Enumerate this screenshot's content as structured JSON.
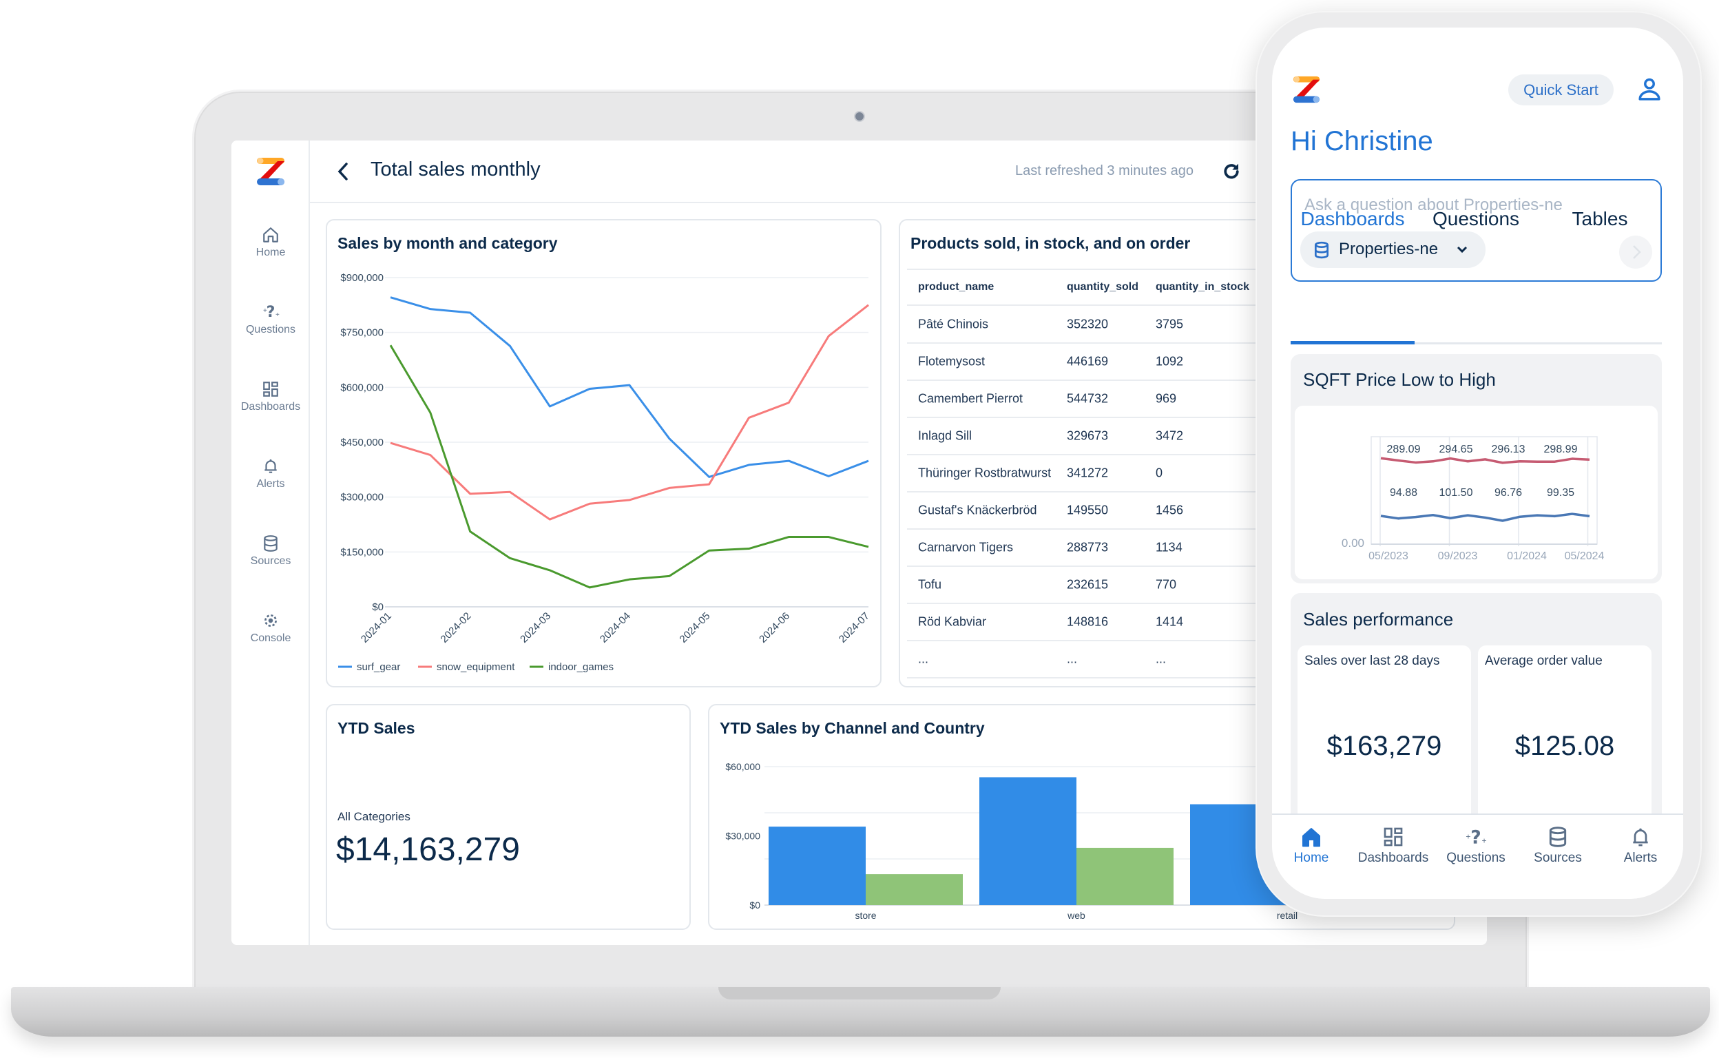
{
  "laptop": {
    "sidebar": {
      "items": [
        {
          "label": "Home",
          "icon": "home-icon"
        },
        {
          "label": "Questions",
          "icon": "sparkle-question-icon"
        },
        {
          "label": "Dashboards",
          "icon": "dashboard-grid-icon"
        },
        {
          "label": "Alerts",
          "icon": "bell-icon"
        },
        {
          "label": "Sources",
          "icon": "database-icon"
        },
        {
          "label": "Console",
          "icon": "gear-icon"
        }
      ]
    },
    "header": {
      "title": "Total sales monthly",
      "last_refreshed": "Last refreshed 3 minutes ago"
    },
    "line_card": {
      "title": "Sales by month and category"
    },
    "table_card": {
      "title": "Products sold, in stock, and on order",
      "columns": [
        "product_name",
        "quantity_sold",
        "quantity_in_stock"
      ],
      "rows": [
        [
          "Pâté Chinois",
          "352320",
          "3795"
        ],
        [
          "Flotemysost",
          "446169",
          "1092"
        ],
        [
          "Camembert Pierrot",
          "544732",
          "969"
        ],
        [
          "Inlagd Sill",
          "329673",
          "3472"
        ],
        [
          "Thüringer Rostbratwurst",
          "341272",
          "0"
        ],
        [
          "Gustaf's Knäckerbröd",
          "149550",
          "1456"
        ],
        [
          "Carnarvon Tigers",
          "288773",
          "1134"
        ],
        [
          "Tofu",
          "232615",
          "770"
        ],
        [
          "Röd Kabviar",
          "148816",
          "1414"
        ],
        [
          "...",
          "...",
          "..."
        ]
      ]
    },
    "ytd_card": {
      "title": "YTD Sales",
      "subtitle": "All Categories",
      "value": "$14,163,279"
    },
    "bar_card": {
      "title": "YTD Sales by Channel and Country"
    }
  },
  "phone": {
    "quick_start": "Quick Start",
    "greeting": "Hi Christine",
    "search_placeholder": "Ask a question about Properties-ne",
    "source_selector": "Properties-ne",
    "tabs": [
      {
        "label": "Dashboards",
        "active": true
      },
      {
        "label": "Questions",
        "active": false
      },
      {
        "label": "Tables",
        "active": false
      }
    ],
    "sqft_card": {
      "title": "SQFT Price Low to High"
    },
    "sales_performance": {
      "title": "Sales performance",
      "metrics": [
        {
          "label": "Sales over last 28 days",
          "value": "$163,279"
        },
        {
          "label": "Average order value",
          "value": "$125.08"
        }
      ]
    },
    "bottom_nav": [
      {
        "label": "Home",
        "icon": "home-filled-icon",
        "active": true
      },
      {
        "label": "Dashboards",
        "icon": "dashboard-grid-icon",
        "active": false
      },
      {
        "label": "Questions",
        "icon": "sparkle-question-icon",
        "active": false
      },
      {
        "label": "Sources",
        "icon": "database-icon",
        "active": false
      },
      {
        "label": "Alerts",
        "icon": "bell-icon",
        "active": false
      }
    ]
  },
  "colors": {
    "primary": "#2174d4",
    "text": "#0c2a4a",
    "surf": "#3a8fe8",
    "snow": "#f77b7b",
    "indoor": "#4a9a2e",
    "bar_blue": "#318ce7",
    "bar_green": "#8fc478"
  },
  "chart_data": [
    {
      "type": "line",
      "title": "Sales by month and category",
      "x": [
        "2024-01-01",
        "2024-01-16",
        "2024-02-01",
        "2024-02-15",
        "2024-03-01",
        "2024-03-16",
        "2024-04-01",
        "2024-04-16",
        "2024-05-01",
        "2024-05-16",
        "2024-06-01",
        "2024-06-16",
        "2024-07-01"
      ],
      "x_ticks": [
        "2024-01",
        "2024-02",
        "2024-03",
        "2024-04",
        "2024-05",
        "2024-06",
        "2024-07"
      ],
      "y_ticks": [
        "$0",
        "$150,000",
        "$300,000",
        "$450,000",
        "$600,000",
        "$750,000",
        "$900,000"
      ],
      "ylim": [
        0,
        900000
      ],
      "grid": true,
      "legend": "bottom-left",
      "series": [
        {
          "name": "surf_gear",
          "color": "#3a8fe8",
          "values": [
            846000,
            814000,
            804000,
            713000,
            548000,
            596000,
            606000,
            460000,
            355000,
            388000,
            399000,
            357000,
            399000
          ]
        },
        {
          "name": "snow_equipment",
          "color": "#f77b7b",
          "values": [
            448000,
            415000,
            309000,
            314000,
            239000,
            282000,
            292000,
            325000,
            335000,
            517000,
            558000,
            740000,
            825000
          ]
        },
        {
          "name": "indoor_games",
          "color": "#4a9a2e",
          "values": [
            715000,
            531000,
            206000,
            133000,
            100000,
            53000,
            75000,
            84000,
            154000,
            159000,
            191000,
            191000,
            164000
          ]
        }
      ]
    },
    {
      "type": "bar",
      "title": "YTD Sales by Channel and Country",
      "categories": [
        "store",
        "web",
        "retail"
      ],
      "y_ticks": [
        "$0",
        "$30,000",
        "$60,000"
      ],
      "ylim": [
        0,
        60000
      ],
      "grid": true,
      "series": [
        {
          "color": "#318ce7",
          "values": [
            34000,
            55400,
            43700
          ]
        },
        {
          "color": "#8fc478",
          "values": [
            13400,
            24800,
            null
          ]
        }
      ]
    },
    {
      "type": "line",
      "title": "SQFT Price Low to High",
      "x": [
        "2023-04",
        "2023-05",
        "2023-06",
        "2023-07",
        "2023-08",
        "2023-09",
        "2023-10",
        "2023-11",
        "2023-12",
        "2024-01",
        "2024-02",
        "2024-03",
        "2024-04"
      ],
      "x_ticks": [
        "05/2023",
        "09/2023",
        "01/2024",
        "05/2024"
      ],
      "y_ticks": [
        "0.00"
      ],
      "ylim": [
        0,
        350
      ],
      "series": [
        {
          "color": "#c65b72",
          "values": [
            301,
            293,
            286,
            290,
            300,
            290,
            297,
            285,
            290,
            289,
            289,
            299,
            296
          ],
          "labels": [
            "289.09",
            "294.65",
            "296.13",
            "298.99"
          ]
        },
        {
          "color": "#4a78b5",
          "values": [
            99,
            90,
            95,
            102,
            91,
            101,
            93,
            82,
            96,
            101,
            98,
            106,
            98
          ],
          "labels": [
            "94.88",
            "101.50",
            "96.76",
            "99.35"
          ]
        }
      ]
    }
  ]
}
